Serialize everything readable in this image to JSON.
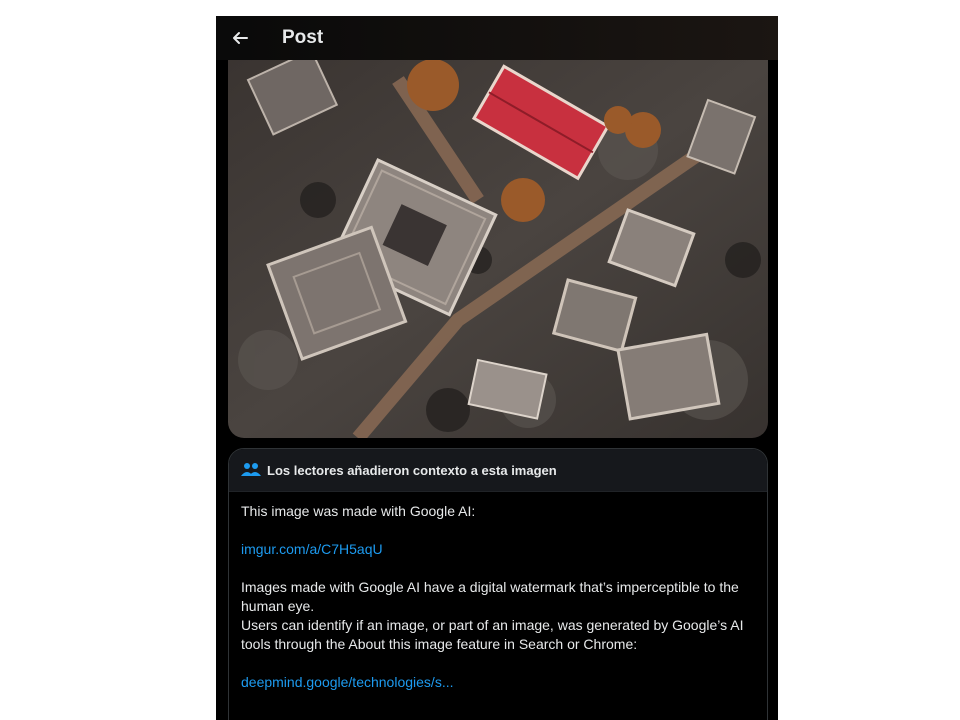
{
  "header": {
    "back_icon": "arrow-left-icon",
    "title": "Post"
  },
  "media": {
    "icon": "image"
  },
  "community_note": {
    "icon": "people-icon",
    "heading": "Los lectores añadieron contexto a esta imagen",
    "line1": "This image was made with Google AI:",
    "link1": "imgur.com/a/C7H5aqU",
    "para2a": "Images made with Google AI have a digital watermark  that’s imperceptible to the human eye.",
    "para2b": "Users can identify if an image, or part of an image, was generated by Google’s AI tools through the About this image feature in Search or Chrome:",
    "link2": "deepmind.google/technologies/s..."
  },
  "colors": {
    "accent": "#1d9bf0",
    "background": "#000000",
    "text": "#e7e9ea"
  }
}
